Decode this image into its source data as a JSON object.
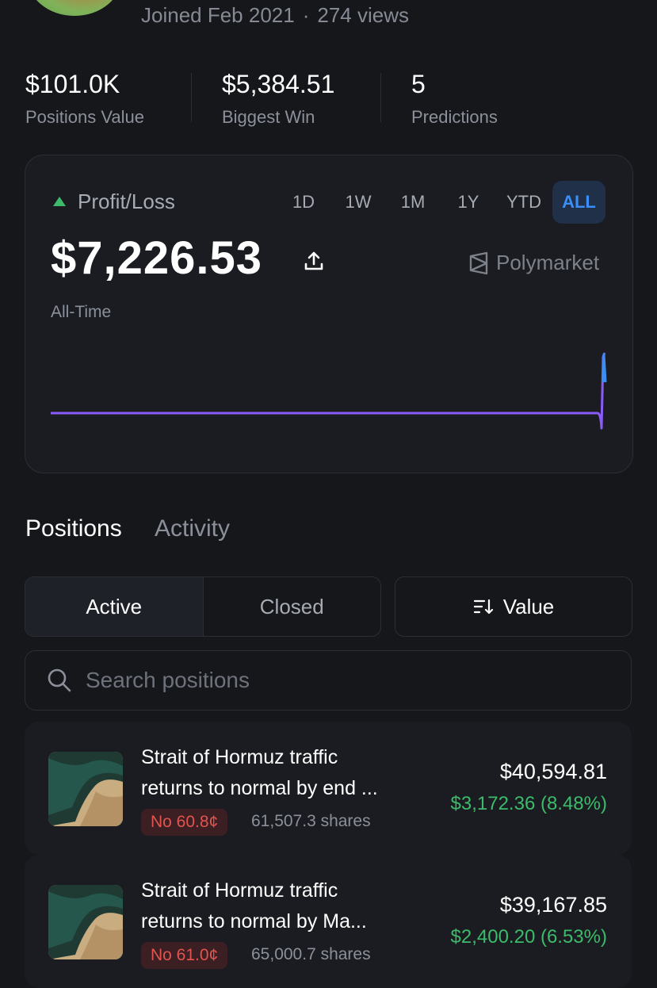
{
  "profile": {
    "joined": "Joined Feb 2021",
    "separator": "·",
    "views": "274 views"
  },
  "stats": [
    {
      "value": "$101.0K",
      "label": "Positions Value"
    },
    {
      "value": "$5,384.51",
      "label": "Biggest Win"
    },
    {
      "value": "5",
      "label": "Predictions"
    }
  ],
  "pnl": {
    "label": "Profit/Loss",
    "value": "$7,226.53",
    "period_label": "All-Time",
    "brand": "Polymarket",
    "ranges": [
      "1D",
      "1W",
      "1M",
      "1Y",
      "YTD",
      "ALL"
    ],
    "active_range": "ALL",
    "colors": {
      "line": "#8a5cf6",
      "spike": "#3a8ef6",
      "up": "#3dbb6a"
    }
  },
  "tabs": {
    "positions": "Positions",
    "activity": "Activity",
    "active": "Positions"
  },
  "filters": {
    "active": "Active",
    "closed": "Closed",
    "sort": "Value"
  },
  "search": {
    "placeholder": "Search positions",
    "value": ""
  },
  "positions": [
    {
      "title_line1": "Strait of Hormuz traffic",
      "title_line2": "returns to normal by end ...",
      "outcome": "No 60.8¢",
      "shares": "61,507.3 shares",
      "value": "$40,594.81",
      "gain": "$3,172.36 (8.48%)"
    },
    {
      "title_line1": "Strait of Hormuz traffic",
      "title_line2": "returns to normal by Ma...",
      "outcome": "No 61.0¢",
      "shares": "65,000.7 shares",
      "value": "$39,167.85",
      "gain": "$2,400.20 (6.53%)"
    }
  ]
}
